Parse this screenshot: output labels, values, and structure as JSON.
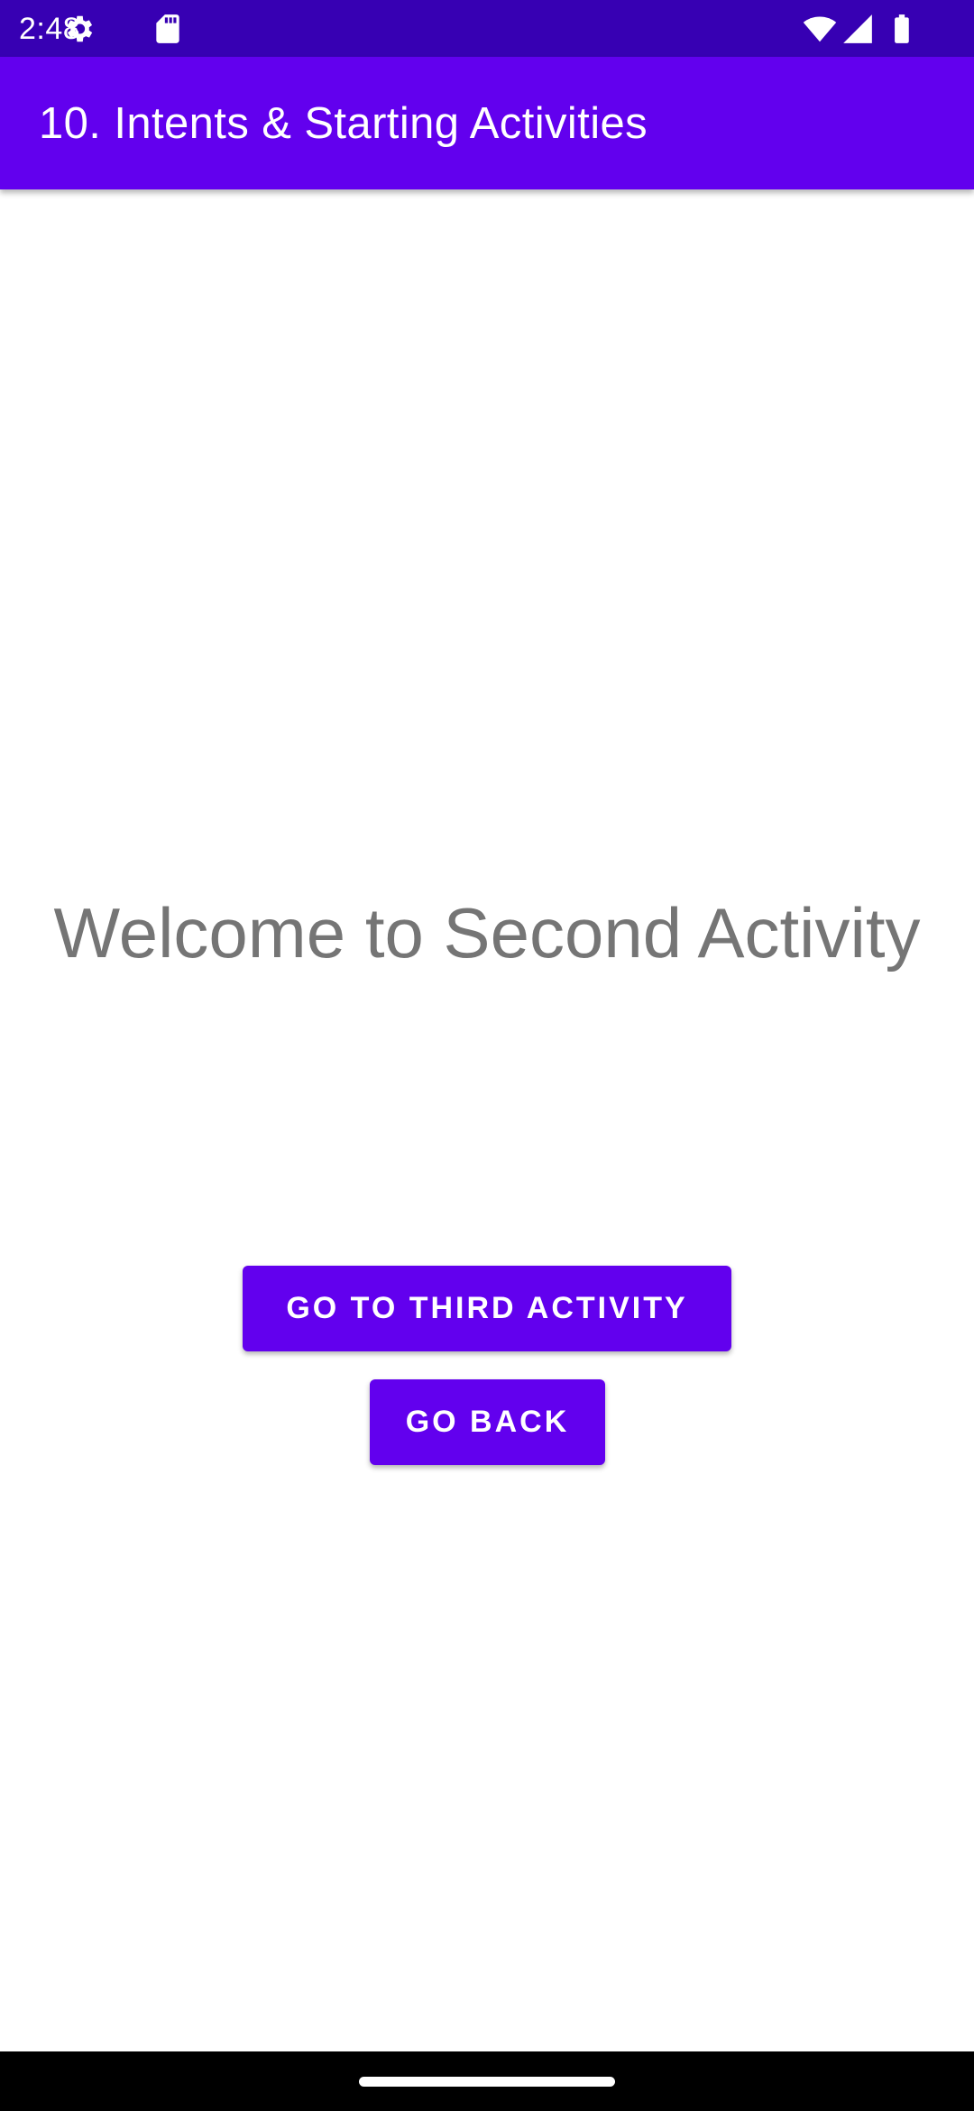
{
  "status_bar": {
    "time": "2:48",
    "left_icons": [
      "settings-gear-icon",
      "sd-card-icon"
    ],
    "right_icons": [
      "wifi-icon",
      "cellular-signal-icon",
      "battery-icon"
    ],
    "background_color": "#3700b3"
  },
  "app_bar": {
    "title": "10. Intents & Starting Activities",
    "background_color": "#6200ee"
  },
  "main": {
    "welcome_text": "Welcome to Second Activity",
    "buttons": {
      "go_to_third_label": "GO TO THIRD ACTIVITY",
      "go_back_label": "GO BACK"
    },
    "button_color": "#6200ee"
  },
  "navigation_bar": {
    "gesture": "home-handle"
  }
}
